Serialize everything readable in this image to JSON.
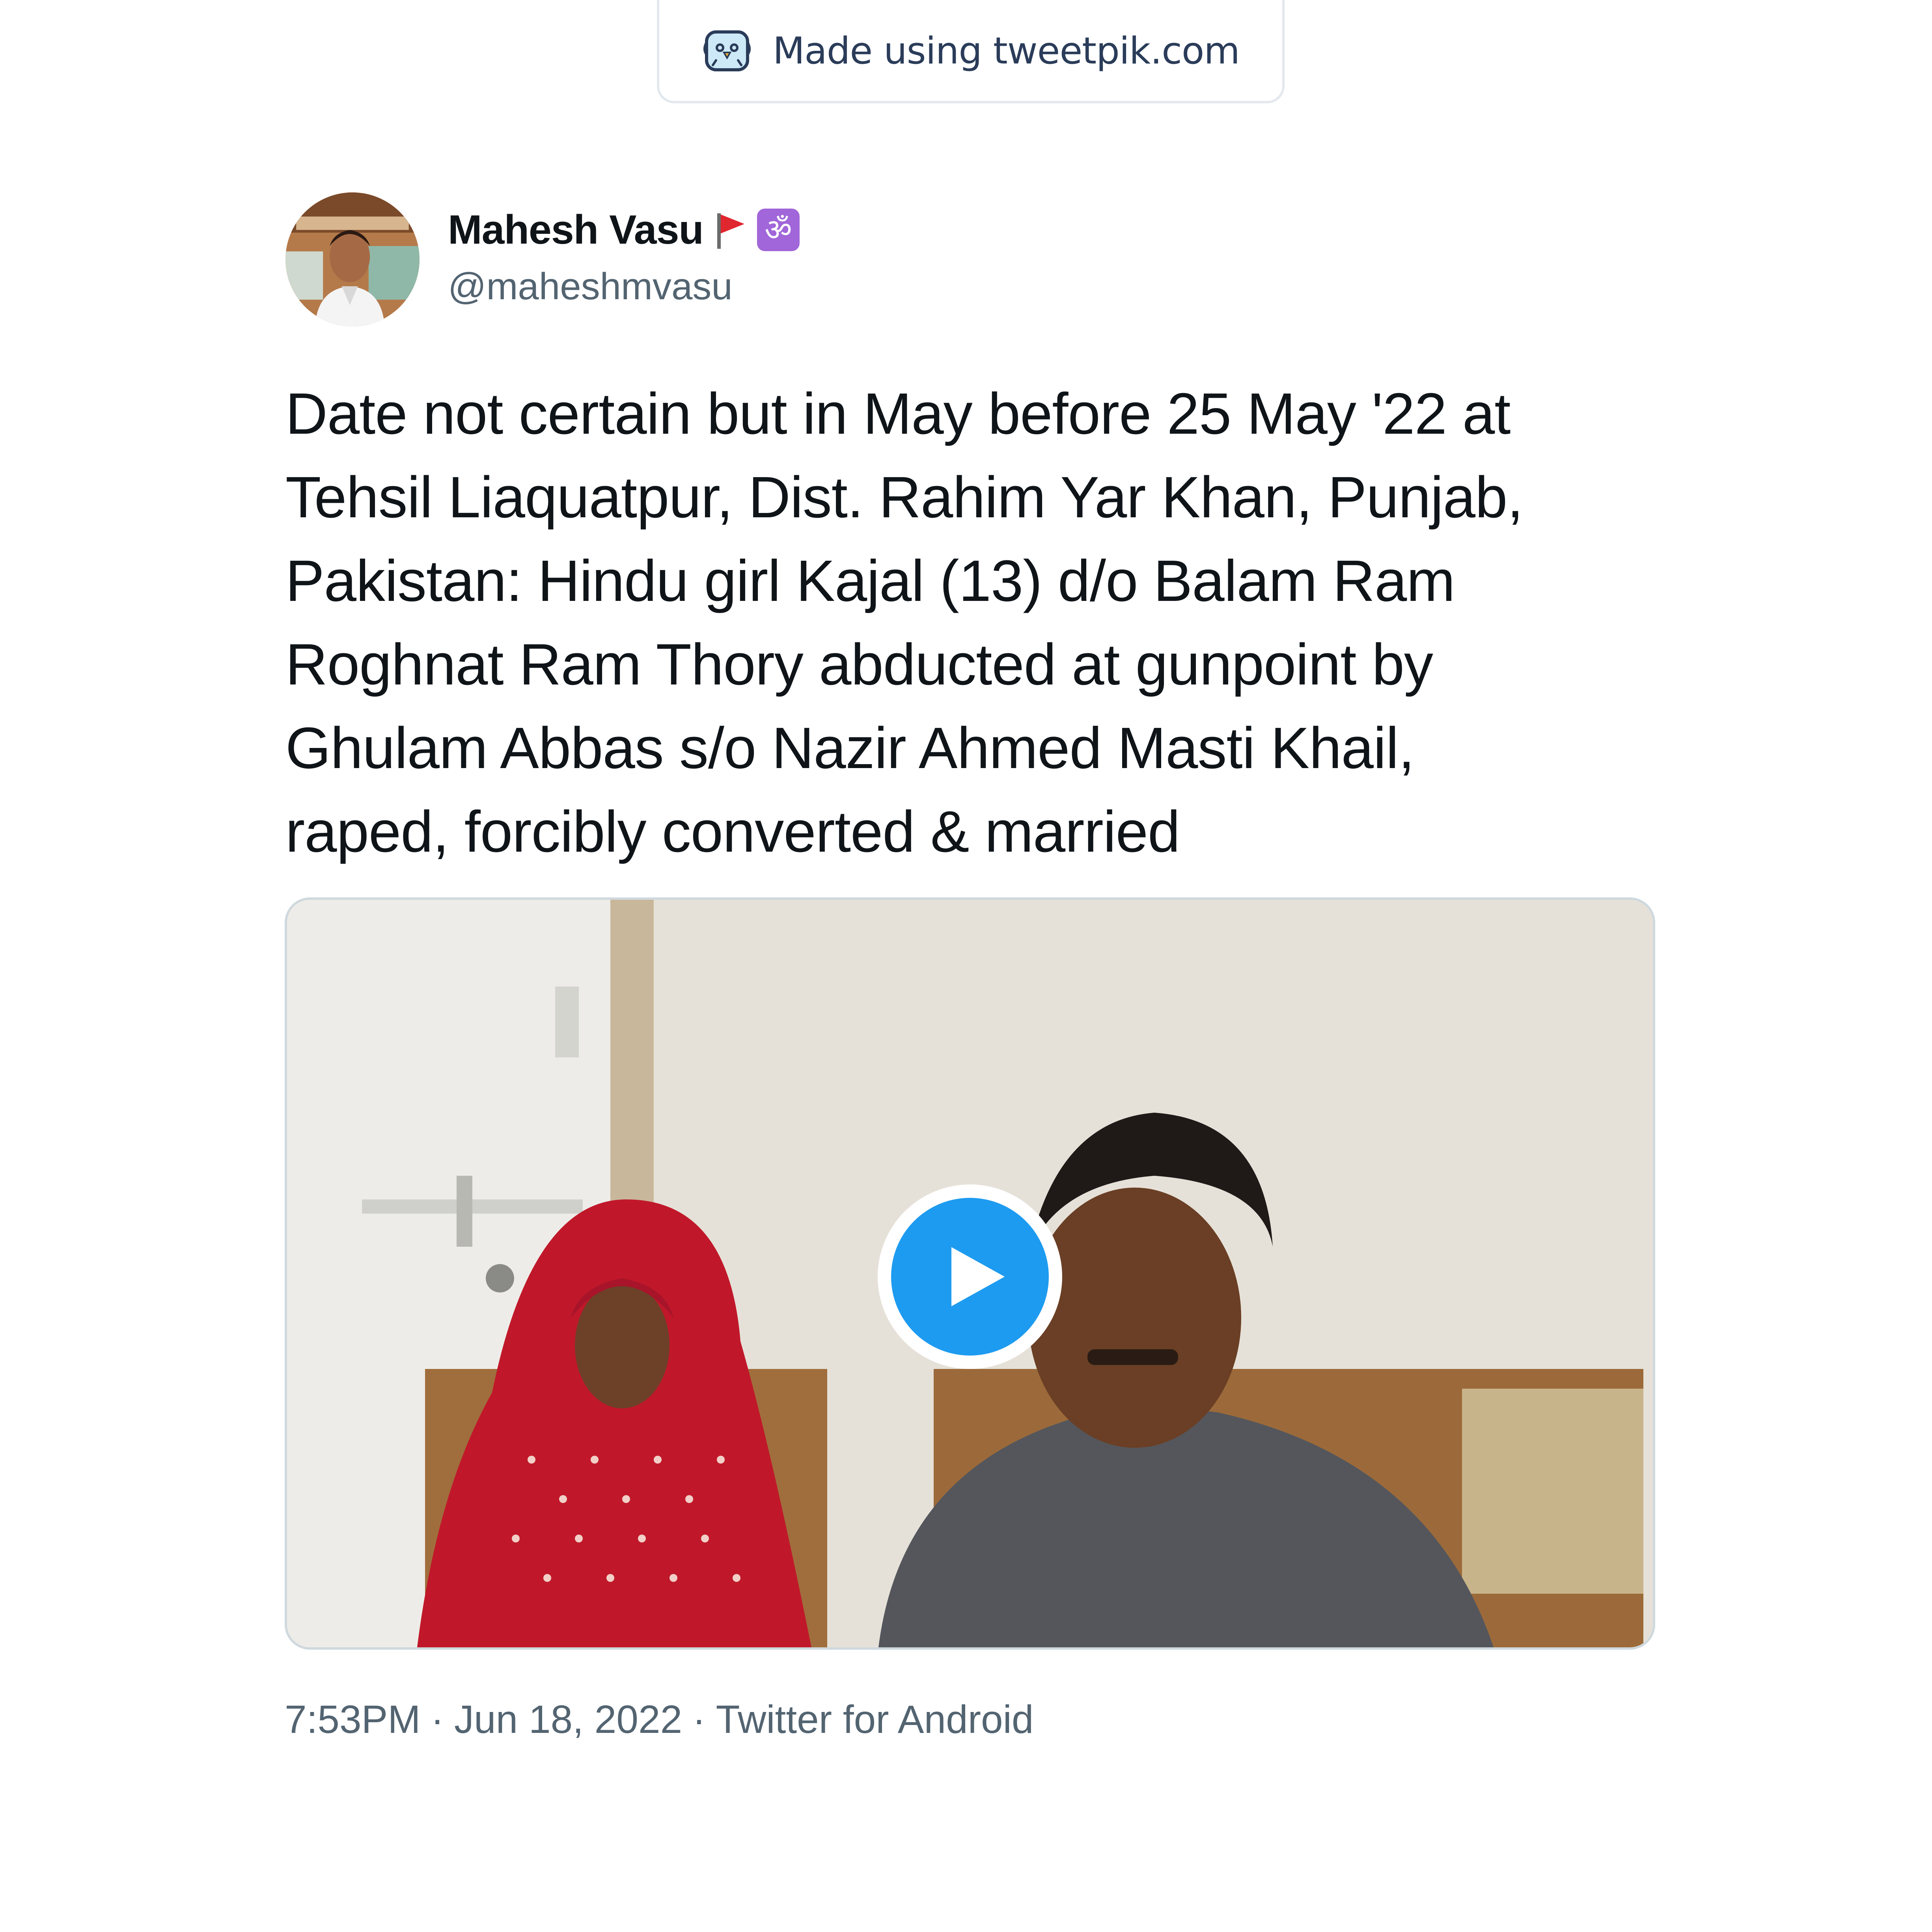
{
  "badge": {
    "text": "Made using tweetpik.com",
    "icon": "bird-face-icon"
  },
  "tweet": {
    "author": {
      "display_name": "Mahesh Vasu",
      "handle": "@maheshmvasu",
      "name_emojis": [
        "red-flag-icon",
        "om-icon"
      ],
      "om_glyph": "ॐ"
    },
    "text_lines": [
      "Date not certain but in May before 25 May '22 at",
      "Tehsil Liaquatpur, Dist. Rahim Yar Khan, Punjab,",
      "Pakistan: Hindu girl Kajal (13) d/o Balam Ram",
      "Roghnat Ram Thory abducted at gunpoint by",
      "Ghulam Abbas s/o Nazir Ahmed Masti Khail,",
      "raped, forcibly converted & married"
    ],
    "media": {
      "type": "video",
      "play_icon": "play-icon"
    },
    "meta": {
      "time": "7:53PM",
      "date": "Jun 18, 2022",
      "source": "Twitter for Android",
      "separator": "·"
    }
  },
  "colors": {
    "accent": "#1d9bf0",
    "text_primary": "#0f1419",
    "text_secondary": "#536471",
    "badge_text": "#2a3c59",
    "om_bg": "#a166d9"
  }
}
